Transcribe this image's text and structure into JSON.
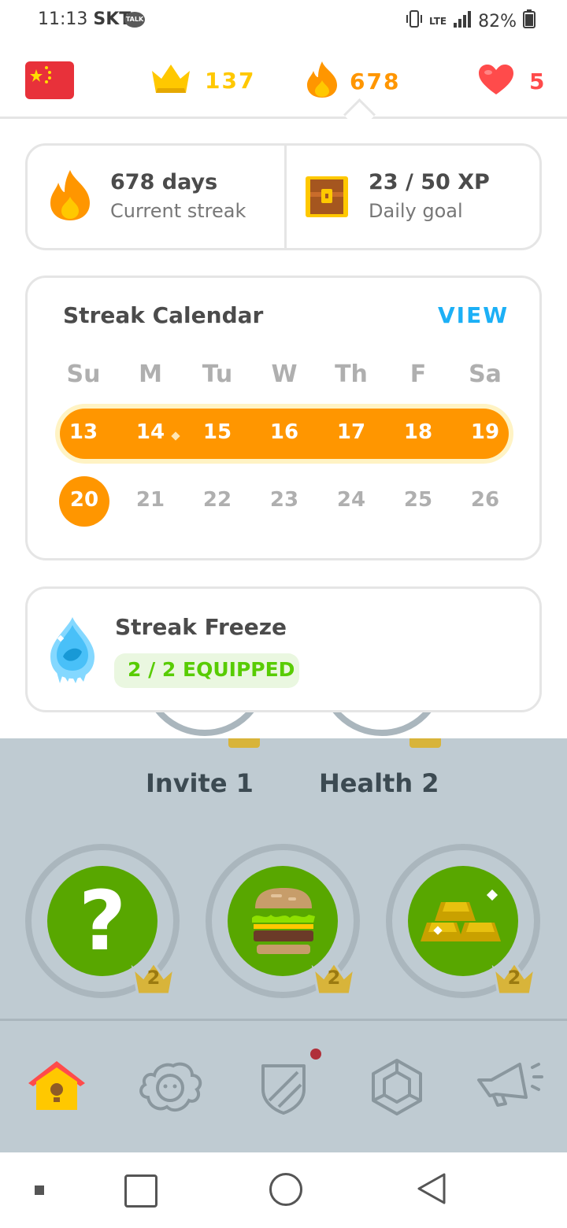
{
  "status_bar": {
    "time": "11:13",
    "carrier": "SKT",
    "talk": "TALK",
    "battery": "82%"
  },
  "header": {
    "crowns": "137",
    "streak": "678",
    "hearts": "5"
  },
  "streak_card": {
    "days": "678 days",
    "days_label": "Current streak",
    "xp": "23 / 50 XP",
    "xp_label": "Daily goal"
  },
  "calendar": {
    "title": "Streak Calendar",
    "view_label": "VIEW",
    "weekdays": [
      "Su",
      "M",
      "Tu",
      "W",
      "Th",
      "F",
      "Sa"
    ],
    "week1": [
      "13",
      "14",
      "15",
      "16",
      "17",
      "18",
      "19"
    ],
    "week2": [
      "20",
      "21",
      "22",
      "23",
      "24",
      "25",
      "26"
    ]
  },
  "freeze": {
    "title": "Streak Freeze",
    "status": "2 / 2 EQUIPPED"
  },
  "skills": {
    "labels": [
      "Invite 1",
      "Health 2"
    ],
    "levels": [
      "2",
      "2",
      "2"
    ],
    "question_mark": "?"
  },
  "icons": {
    "flag": "china-flag-icon",
    "crown": "crown-icon",
    "fire": "fire-icon",
    "heart": "heart-icon",
    "chest": "treasure-chest-icon",
    "freeze": "ice-drop-icon",
    "nav": [
      "home-icon",
      "characters-icon",
      "shield-icon",
      "gem-icon",
      "megaphone-icon"
    ]
  },
  "colors": {
    "orange": "#ff9600",
    "gold": "#ffc800",
    "red": "#ff4b4b",
    "blue": "#1cb0f6",
    "green": "#58a700",
    "gray_bg": "#bfcbd2"
  }
}
